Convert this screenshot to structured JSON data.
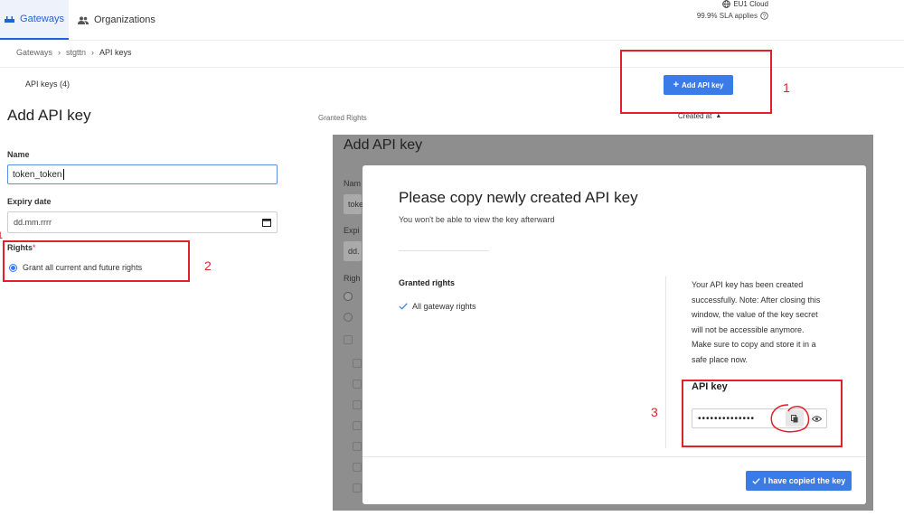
{
  "nav": {
    "gateways": "Gateways",
    "organizations": "Organizations",
    "region": "EU1 Cloud",
    "sla": "99.9% SLA applies"
  },
  "breadcrumb": {
    "items": [
      "Gateways",
      "stgttn",
      "API keys"
    ]
  },
  "list": {
    "count_label": "API keys (4)",
    "granted_rights_header": "Granted Rights",
    "created_at_header": "Created at",
    "add_button": "Add API key"
  },
  "form": {
    "title": "Add API key",
    "name_label": "Name",
    "name_value": "token_token",
    "expiry_label": "Expiry date",
    "expiry_placeholder": "dd.mm.rrrr",
    "rights_label": "Rights",
    "required_mark": "*",
    "grant_all_label": "Grant all current and future rights"
  },
  "overlay_bg": {
    "title": "Add API key",
    "name_fragment": "Nam",
    "name_value_fragment": "toke",
    "expiry_fragment": "Expi",
    "date_fragment": "dd.",
    "rights_fragment": "Righ"
  },
  "modal": {
    "title": "Please copy newly created API key",
    "subtitle": "You won't be able to view the key afterward",
    "granted_rights_label": "Granted rights",
    "granted_right_item": "All gateway rights",
    "note_lines": [
      "Your API key has been created",
      "successfully. Note: After closing this",
      "window, the value of the key secret",
      "will not be accessible anymore.",
      "Make sure to copy and store it in a",
      "safe place now."
    ],
    "api_key_label": "API key",
    "api_key_masked": "••••••••••••••",
    "copied_button": "I have copied the key"
  },
  "annotations": {
    "n1": "1",
    "n2": "2",
    "n3": "3",
    "stray": "1"
  },
  "colors": {
    "accent": "#3b7be8",
    "annotation_red": "#e3202a"
  }
}
